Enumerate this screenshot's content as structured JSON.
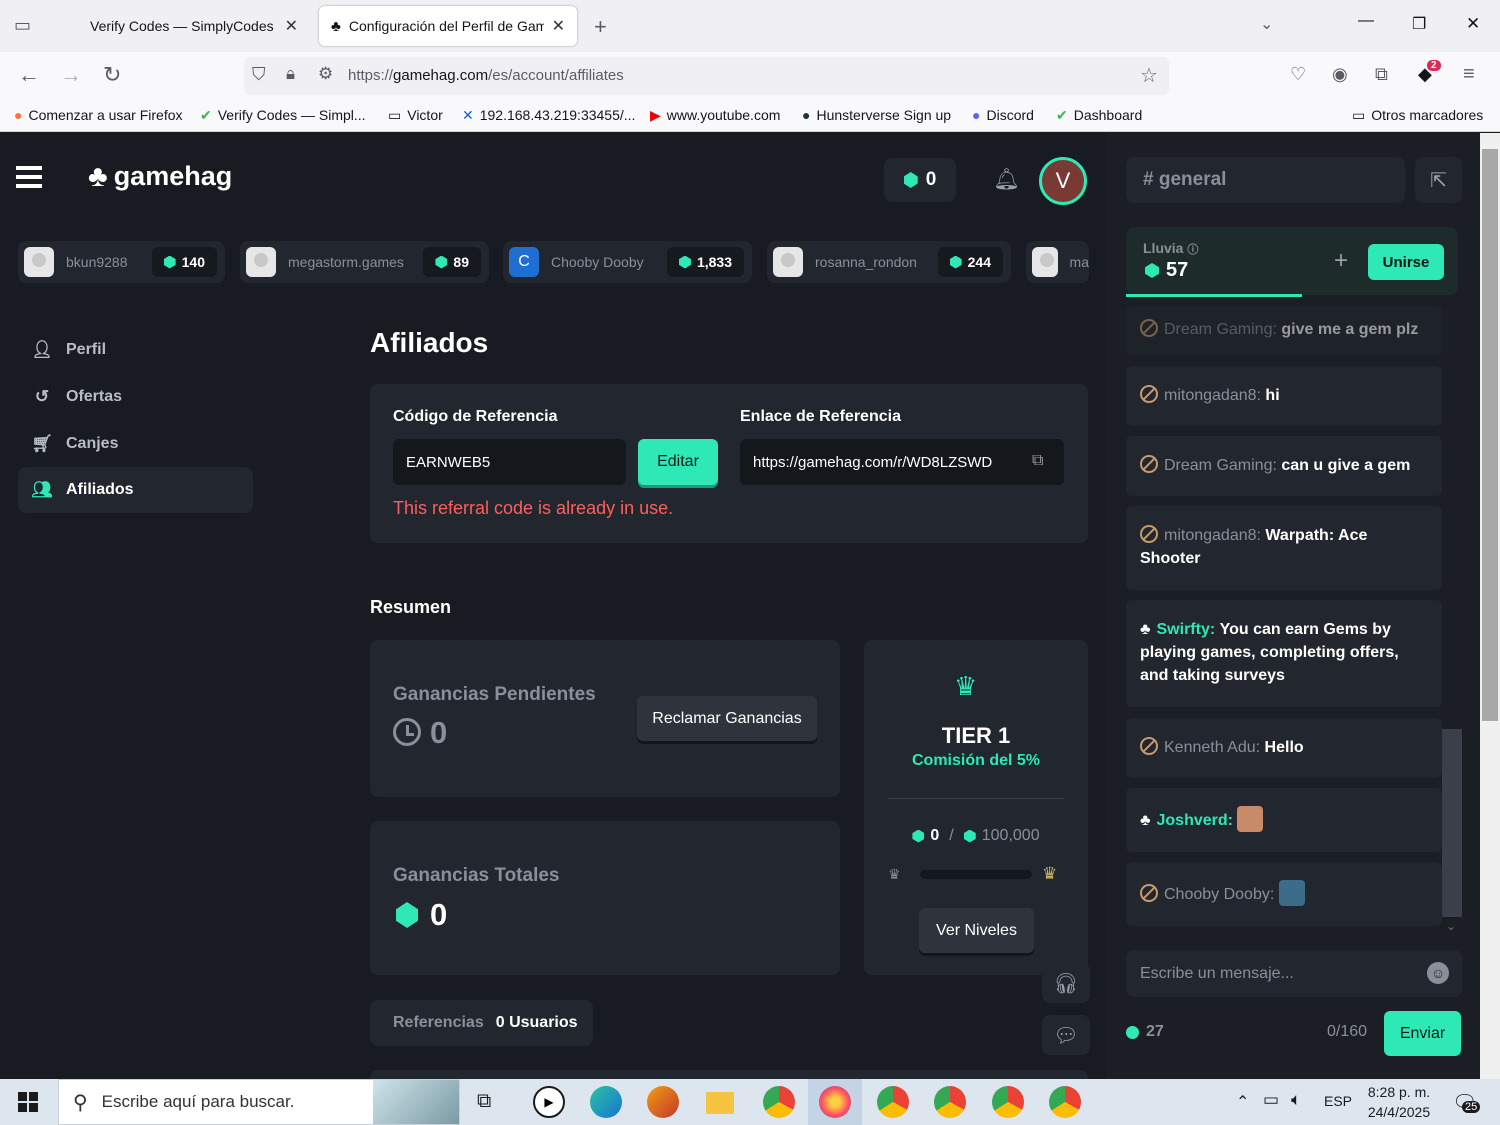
{
  "browser": {
    "tabs": [
      {
        "title": "Verify Codes — SimplyCodes"
      },
      {
        "title": "Configuración del Perfil de Gam"
      }
    ],
    "url_prefix": "https://",
    "url_domain": "gamehag.com",
    "url_path": "/es/account/affiliates",
    "bookmarks": [
      {
        "label": "Comenzar a usar Firefox"
      },
      {
        "label": "Verify Codes — Simpl..."
      },
      {
        "label": "Victor"
      },
      {
        "label": "192.168.43.219:33455/..."
      },
      {
        "label": "www.youtube.com"
      },
      {
        "label": "Hunsterverse Sign up"
      },
      {
        "label": "Discord"
      },
      {
        "label": "Dashboard"
      },
      {
        "label": "Otros marcadores"
      }
    ],
    "extension_badge": "2"
  },
  "header": {
    "logo_text": "gamehag",
    "gem_balance": "0",
    "avatar_letter": "V"
  },
  "recent_users": [
    {
      "name": "bkun9288",
      "gems": "140"
    },
    {
      "name": "megastorm.games",
      "gems": "89"
    },
    {
      "name": "Chooby Dooby",
      "gems": "1,833",
      "initial": "C"
    },
    {
      "name": "rosanna_rondon",
      "gems": "244"
    },
    {
      "name": "ma"
    }
  ],
  "sidebar": {
    "items": [
      {
        "label": "Perfil"
      },
      {
        "label": "Ofertas"
      },
      {
        "label": "Canjes"
      },
      {
        "label": "Afiliados"
      }
    ]
  },
  "main": {
    "title": "Afiliados",
    "referral_code_label": "Código de Referencia",
    "referral_code_value": "EARNWEB5",
    "edit_button": "Editar",
    "referral_link_label": "Enlace de Referencia",
    "referral_link_value": "https://gamehag.com/r/WD8LZSWD",
    "error_text": "This referral code is already in use.",
    "summary_title": "Resumen",
    "pending_label": "Ganancias Pendientes",
    "pending_value": "0",
    "claim_button": "Reclamar Ganancias",
    "total_label": "Ganancias Totales",
    "total_value": "0",
    "tier_title": "TIER 1",
    "tier_commission": "Comisión del 5%",
    "tier_progress_current": "0",
    "tier_progress_separator": "/",
    "tier_progress_target": "100,000",
    "tier_progress_fraction": 0.0,
    "levels_button": "Ver Niveles",
    "referrals_label": "Referencias",
    "referrals_value": "0 Usuarios"
  },
  "chat": {
    "channel": "# general",
    "rain_label": "Lluvia",
    "rain_value": "57",
    "join_button": "Unirse",
    "messages": [
      {
        "user": "Dream Gaming:",
        "text": "give me a gem plz"
      },
      {
        "user": "mitongadan8:",
        "text": "hi"
      },
      {
        "user": "Dream Gaming:",
        "text": "can u give a gem"
      },
      {
        "user": "mitongadan8:",
        "text": "Warpath: Ace Shooter"
      },
      {
        "user": "Swirfty:",
        "text": "You can earn Gems by playing games, completing offers, and taking surveys"
      },
      {
        "user": "Kenneth Adu:",
        "text": "Hello"
      },
      {
        "user": "Joshverd:",
        "text": ""
      },
      {
        "user": "Chooby Dooby:",
        "text": ""
      }
    ],
    "input_placeholder": "Escribe un mensaje...",
    "online_count": "27",
    "char_counter": "0/160",
    "send_button": "Enviar"
  },
  "taskbar": {
    "search_placeholder": "Escribe aquí para buscar.",
    "language": "ESP",
    "time": "8:28 p. m.",
    "date": "24/4/2025",
    "notifications": "25"
  },
  "colors": {
    "accent": "#2ee8b6",
    "background": "#181b21",
    "card": "#22262e",
    "error": "#ff5e5e"
  }
}
